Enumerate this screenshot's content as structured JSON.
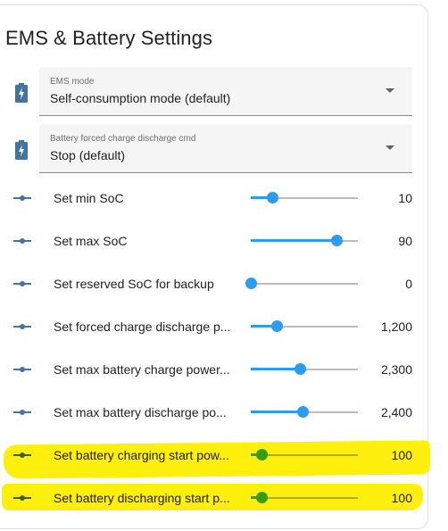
{
  "card": {
    "title": "EMS & Battery Settings"
  },
  "selects": [
    {
      "icon": "battery-charging-icon",
      "label": "EMS mode",
      "value": "Self-consumption mode (default)"
    },
    {
      "icon": "battery-charging-icon",
      "label": "Battery forced charge discharge cmd",
      "value": "Stop (default)"
    }
  ],
  "numbers": [
    {
      "icon": "ray-vertex-icon",
      "label": "Set min SoC",
      "value": "10",
      "level": 0.2
    },
    {
      "icon": "ray-vertex-icon",
      "label": "Set max SoC",
      "value": "90",
      "level": 0.8
    },
    {
      "icon": "ray-vertex-icon",
      "label": "Set reserved SoC for backup",
      "value": "0",
      "level": 0.0
    },
    {
      "icon": "ray-vertex-icon",
      "label": "Set forced charge discharge p...",
      "value": "1,200",
      "level": 0.24
    },
    {
      "icon": "ray-vertex-icon",
      "label": "Set max battery charge power...",
      "value": "2,300",
      "level": 0.46
    },
    {
      "icon": "ray-vertex-icon",
      "label": "Set max battery discharge po...",
      "value": "2,400",
      "level": 0.48
    },
    {
      "icon": "ray-vertex-icon",
      "label": "Set battery charging start pow...",
      "value": "100",
      "level": 0.1
    },
    {
      "icon": "ray-vertex-icon",
      "label": "Set battery discharging start p...",
      "value": "100",
      "level": 0.1
    }
  ],
  "colors": {
    "accent": "#2d9cf0",
    "icon": "#44739e",
    "highlight": "#ffee00",
    "highlighted_slider": "#3a9a10"
  }
}
